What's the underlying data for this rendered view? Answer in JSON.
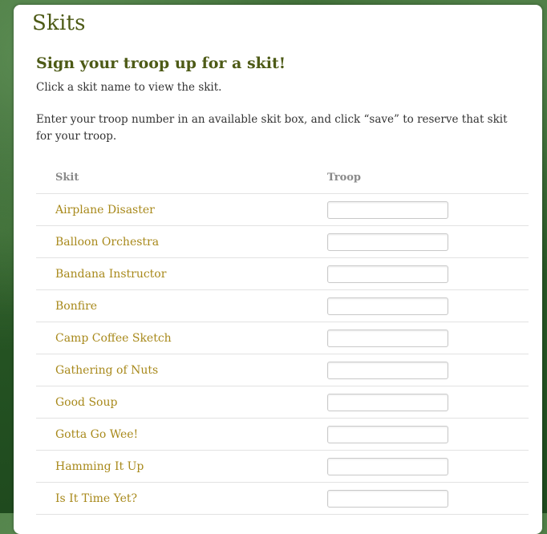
{
  "page": {
    "title": "Skits",
    "heading": "Sign your troop up for a skit!",
    "instructions": [
      "Click a skit name to view the skit.",
      "Enter your troop number in an available skit box, and click “save”  to reserve that skit for your troop."
    ]
  },
  "table": {
    "headers": {
      "skit": "Skit",
      "troop": "Troop"
    },
    "rows": [
      {
        "skit": "Airplane Disaster",
        "troop": ""
      },
      {
        "skit": "Balloon Orchestra",
        "troop": ""
      },
      {
        "skit": "Bandana Instructor",
        "troop": ""
      },
      {
        "skit": "Bonfire",
        "troop": ""
      },
      {
        "skit": "Camp Coffee Sketch",
        "troop": ""
      },
      {
        "skit": "Gathering of Nuts",
        "troop": ""
      },
      {
        "skit": "Good Soup",
        "troop": ""
      },
      {
        "skit": "Gotta Go Wee!",
        "troop": ""
      },
      {
        "skit": "Hamming It Up",
        "troop": ""
      },
      {
        "skit": "Is It Time Yet?",
        "troop": ""
      }
    ]
  },
  "colors": {
    "heading": "#4d5a16",
    "link": "#a8891b",
    "body_text": "#333333",
    "header_text": "#8a8a8a",
    "background_green": "#2d5a28"
  }
}
